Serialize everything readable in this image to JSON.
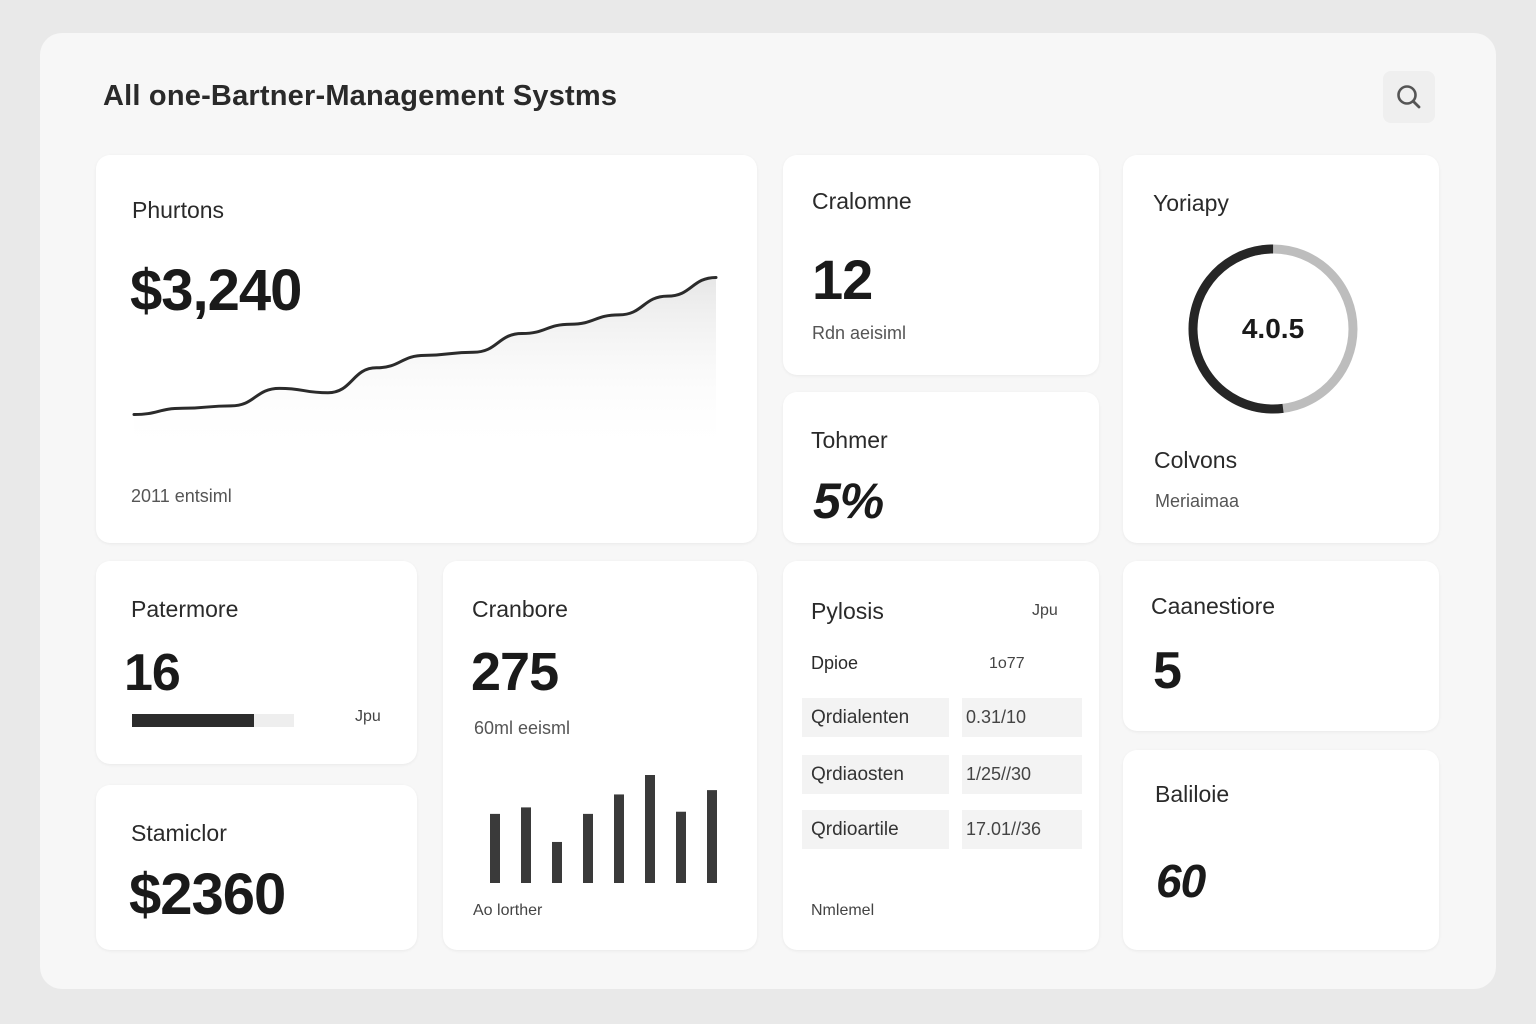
{
  "header": {
    "title": "All one-Bartner-Management Systms",
    "search_icon": "search-icon"
  },
  "cards": {
    "revenue": {
      "title": "Phurtons",
      "value": "$3,240",
      "footnote": "2011 entsiml"
    },
    "count12": {
      "title": "Cralomne",
      "value": "12",
      "caption": "Rdn aeisiml"
    },
    "percent": {
      "title": "Tohmer",
      "value": "5%"
    },
    "ring": {
      "title": "Yoriapy",
      "center_value": "4.0.5",
      "label": "Colvons",
      "sublabel": "Meriaimaa",
      "fraction": 0.52
    },
    "partners": {
      "title": "Patermore",
      "value": "16",
      "tag": "Jpu",
      "progress": 0.75
    },
    "bars": {
      "title": "Cranbore",
      "value": "275",
      "caption": "60ml eeisml",
      "footer": "Ao lorther"
    },
    "table": {
      "title": "Pylosis",
      "tag": "Jpu",
      "header_label": "Dpioe",
      "header_value": "1o77",
      "rows": [
        {
          "label": "Qrdialenten",
          "date": "0.31/10"
        },
        {
          "label": "Qrdiaosten",
          "date": "1/25//30"
        },
        {
          "label": "Qrdioartile",
          "date": "17.01//36"
        }
      ],
      "footer": "Nmlemel"
    },
    "count5": {
      "title": "Caanestiore",
      "value": "5"
    },
    "spend": {
      "title": "Stamiclor",
      "value": "$2360"
    },
    "balance": {
      "title": "Baliloie",
      "value": "60"
    }
  },
  "chart_data": [
    {
      "type": "area",
      "x": [
        0,
        1,
        2,
        3,
        4,
        5,
        6,
        7,
        8,
        9,
        10,
        11,
        12
      ],
      "values": [
        2,
        3,
        3.4,
        6.2,
        5.5,
        9.5,
        11.5,
        12,
        15,
        16.5,
        18,
        21,
        24
      ],
      "ylim": [
        0,
        26
      ]
    },
    {
      "type": "bar",
      "values": [
        64,
        70,
        38,
        64,
        82,
        100,
        66,
        86
      ],
      "ylim": [
        0,
        100
      ]
    }
  ],
  "colors": {
    "panel": "#f7f7f7",
    "card": "#ffffff",
    "ink": "#1f1f1f",
    "accent_dark": "#2c2c2c",
    "ring_light": "#bdbdbd"
  }
}
